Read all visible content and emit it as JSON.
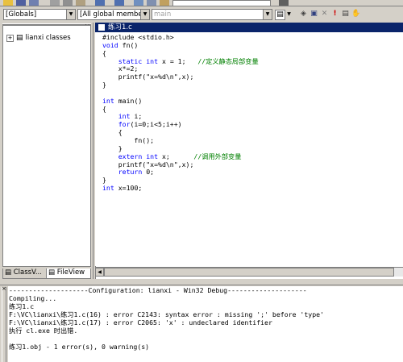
{
  "toolbar2": {
    "scope_combo": "[Globals]",
    "members_combo": "[All global members",
    "function_combo": "main"
  },
  "workspace": {
    "tree_root": "lianxi classes",
    "tab_classview": "ClassV...",
    "tab_fileview": "FileView"
  },
  "editor": {
    "title": "练习1.c",
    "lines": [
      {
        "segs": [
          {
            "t": "#include <stdio.h>",
            "c": ""
          }
        ]
      },
      {
        "segs": [
          {
            "t": "void",
            "c": "kw"
          },
          {
            "t": " fn()",
            "c": ""
          }
        ]
      },
      {
        "segs": [
          {
            "t": "{",
            "c": ""
          }
        ]
      },
      {
        "segs": [
          {
            "t": "    ",
            "c": ""
          },
          {
            "t": "static",
            "c": "kw"
          },
          {
            "t": " ",
            "c": ""
          },
          {
            "t": "int",
            "c": "kw"
          },
          {
            "t": " x = 1;   ",
            "c": ""
          },
          {
            "t": "//定义静态局部变量",
            "c": "cm"
          }
        ]
      },
      {
        "segs": [
          {
            "t": "    x*=2;",
            "c": ""
          }
        ]
      },
      {
        "segs": [
          {
            "t": "    printf(\"x=%d\\n\",x);",
            "c": ""
          }
        ]
      },
      {
        "segs": [
          {
            "t": "}",
            "c": ""
          }
        ]
      },
      {
        "segs": [
          {
            "t": "",
            "c": ""
          }
        ]
      },
      {
        "segs": [
          {
            "t": "int",
            "c": "kw"
          },
          {
            "t": " main()",
            "c": ""
          }
        ]
      },
      {
        "segs": [
          {
            "t": "{",
            "c": ""
          }
        ]
      },
      {
        "segs": [
          {
            "t": "    ",
            "c": ""
          },
          {
            "t": "int",
            "c": "kw"
          },
          {
            "t": " i;",
            "c": ""
          }
        ]
      },
      {
        "segs": [
          {
            "t": "    ",
            "c": ""
          },
          {
            "t": "for",
            "c": "kw"
          },
          {
            "t": "(i=0;i<5;i++)",
            "c": ""
          }
        ]
      },
      {
        "segs": [
          {
            "t": "    {",
            "c": ""
          }
        ]
      },
      {
        "segs": [
          {
            "t": "        fn();",
            "c": ""
          }
        ]
      },
      {
        "segs": [
          {
            "t": "    }",
            "c": ""
          }
        ]
      },
      {
        "segs": [
          {
            "t": "    ",
            "c": ""
          },
          {
            "t": "extern",
            "c": "kw"
          },
          {
            "t": " ",
            "c": ""
          },
          {
            "t": "int",
            "c": "kw"
          },
          {
            "t": " x;      ",
            "c": ""
          },
          {
            "t": "//调用外部变量",
            "c": "cm"
          }
        ]
      },
      {
        "segs": [
          {
            "t": "    printf(\"x=%d\\n\",x);",
            "c": ""
          }
        ]
      },
      {
        "segs": [
          {
            "t": "    ",
            "c": ""
          },
          {
            "t": "return",
            "c": "kw"
          },
          {
            "t": " 0;",
            "c": ""
          }
        ]
      },
      {
        "segs": [
          {
            "t": "}",
            "c": ""
          }
        ]
      },
      {
        "segs": [
          {
            "t": "int",
            "c": "kw"
          },
          {
            "t": " x=100;",
            "c": ""
          }
        ]
      }
    ]
  },
  "output": {
    "lines": [
      "--------------------Configuration: lianxi - Win32 Debug--------------------",
      "Compiling...",
      "练习1.c",
      "F:\\VC\\lianxi\\练习1.c(16) : error C2143: syntax error : missing ';' before 'type'",
      "F:\\VC\\lianxi\\练习1.c(17) : error C2065: 'x' : undeclared identifier",
      "执行 cl.exe 时出错.",
      "",
      "练习1.obj - 1 error(s), 0 warning(s)"
    ]
  },
  "colors": {
    "keyword": "#0000ff",
    "comment": "#008000",
    "title_bar": "#0a246a",
    "chrome": "#d4d0c8"
  }
}
